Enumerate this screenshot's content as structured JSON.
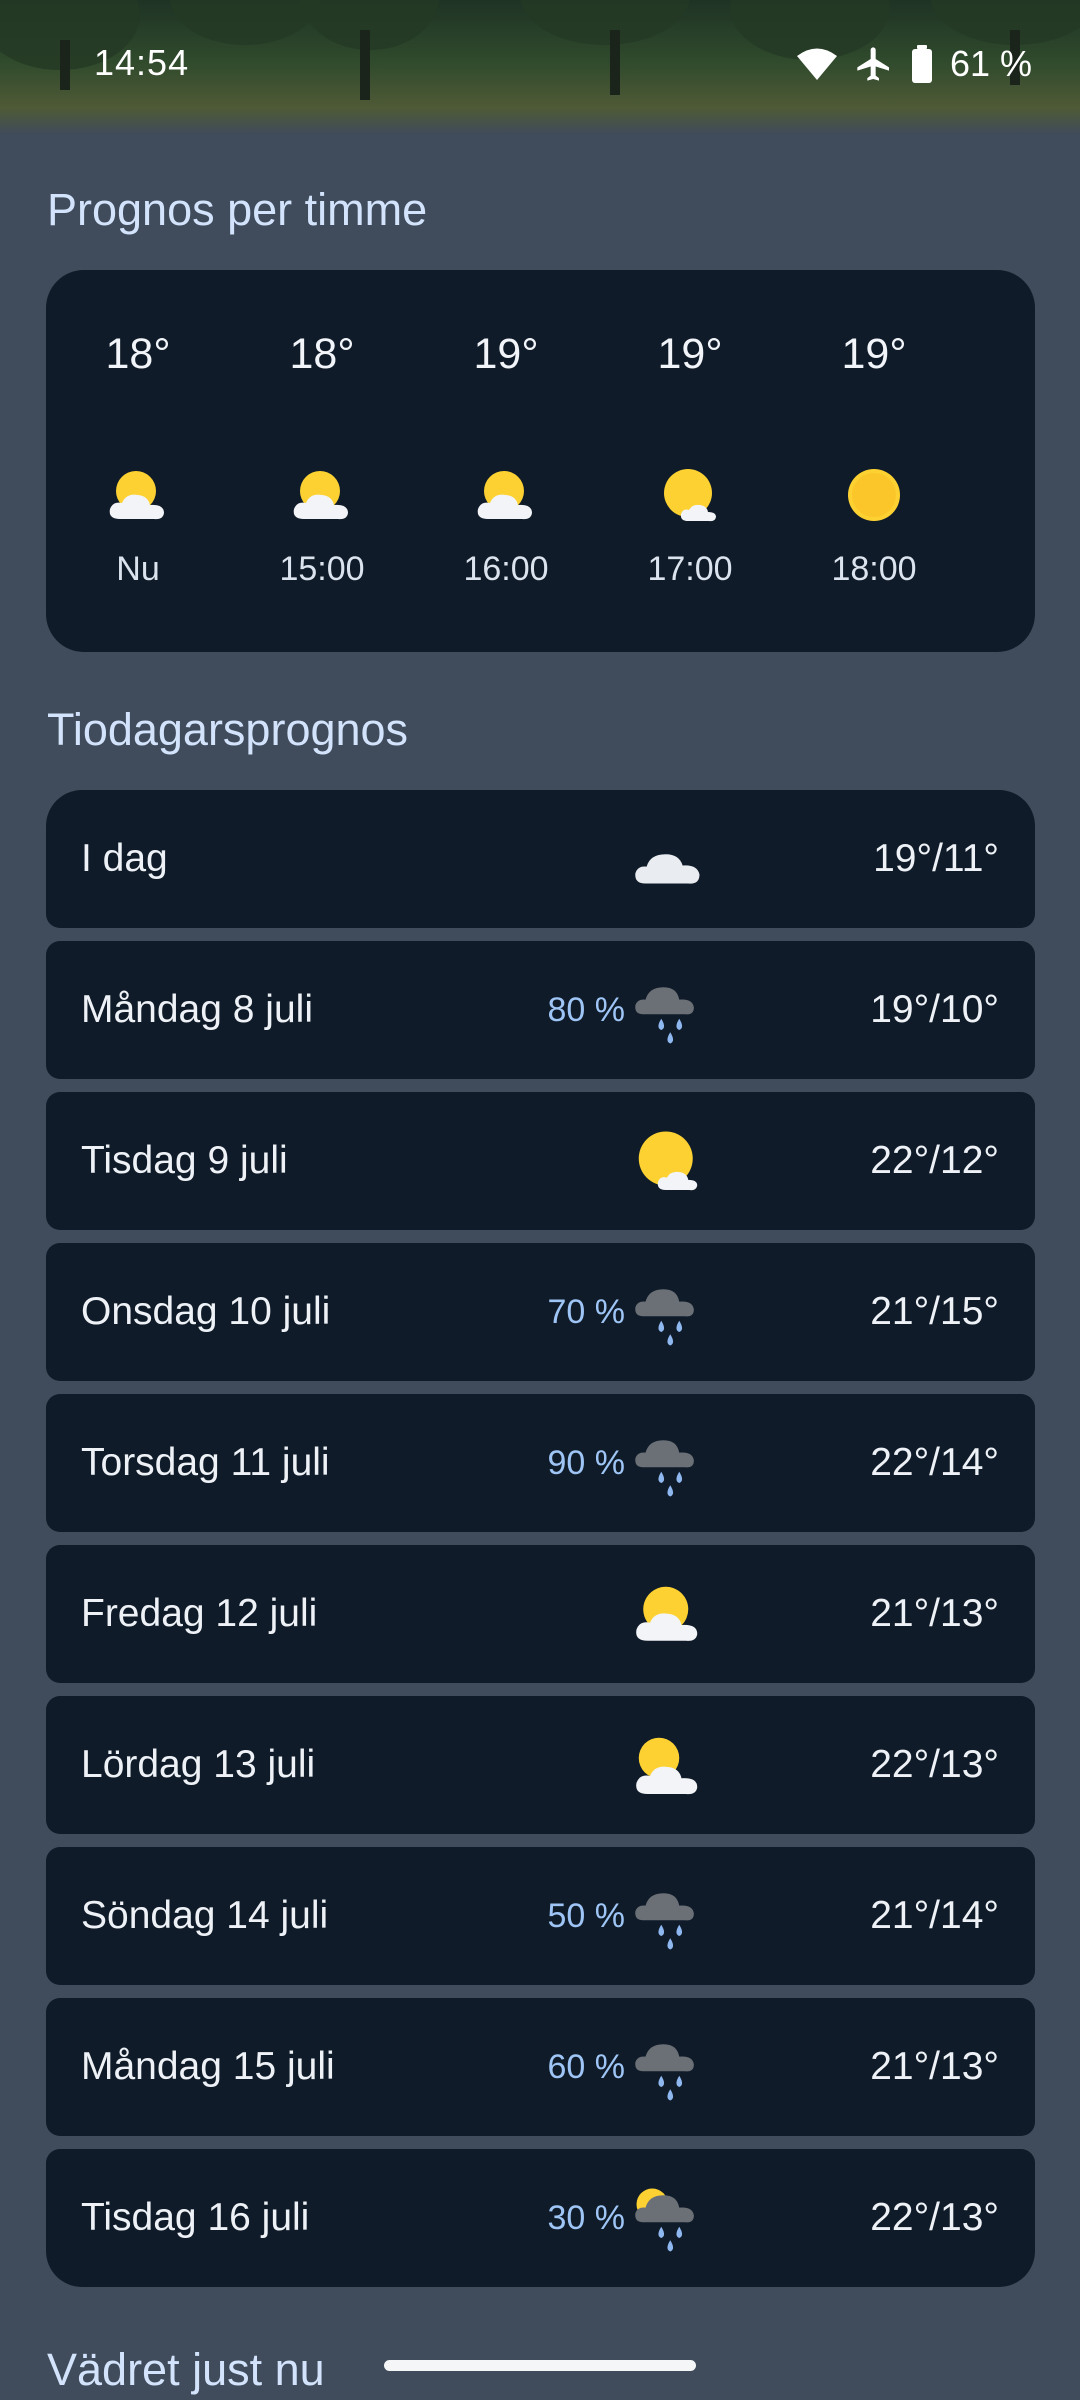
{
  "status_bar": {
    "time": "14:54",
    "battery": "61 %"
  },
  "hourly": {
    "title": "Prognos per timme",
    "items": [
      {
        "temp": "18°",
        "label": "Nu",
        "icon": "partly-cloudy-icon"
      },
      {
        "temp": "18°",
        "label": "15:00",
        "icon": "partly-cloudy-icon"
      },
      {
        "temp": "19°",
        "label": "16:00",
        "icon": "partly-cloudy-icon"
      },
      {
        "temp": "19°",
        "label": "17:00",
        "icon": "mostly-sunny-icon"
      },
      {
        "temp": "19°",
        "label": "18:00",
        "icon": "sunny-icon"
      }
    ]
  },
  "ten_day": {
    "title": "Tiodagarsprognos",
    "days": [
      {
        "name": "I dag",
        "precip": "",
        "icon": "cloudy-icon",
        "temps": "19°/11°"
      },
      {
        "name": "Måndag 8 juli",
        "precip": "80 %",
        "icon": "rain-icon",
        "temps": "19°/10°"
      },
      {
        "name": "Tisdag 9 juli",
        "precip": "",
        "icon": "mostly-sunny-icon",
        "temps": "22°/12°"
      },
      {
        "name": "Onsdag 10 juli",
        "precip": "70 %",
        "icon": "rain-icon",
        "temps": "21°/15°"
      },
      {
        "name": "Torsdag 11 juli",
        "precip": "90 %",
        "icon": "rain-icon",
        "temps": "22°/14°"
      },
      {
        "name": "Fredag 12 juli",
        "precip": "",
        "icon": "partly-cloudy-icon",
        "temps": "21°/13°"
      },
      {
        "name": "Lördag 13 juli",
        "precip": "",
        "icon": "partly-cloudy-icon",
        "temps": "22°/13°"
      },
      {
        "name": "Söndag 14 juli",
        "precip": "50 %",
        "icon": "rain-icon",
        "temps": "21°/14°"
      },
      {
        "name": "Måndag 15 juli",
        "precip": "60 %",
        "icon": "rain-icon",
        "temps": "21°/13°"
      },
      {
        "name": "Tisdag 16 juli",
        "precip": "30 %",
        "icon": "sun-rain-icon",
        "temps": "22°/13°"
      }
    ]
  },
  "current": {
    "title": "Vädret just nu"
  },
  "colors": {
    "background": "#404b5b",
    "card": "#0f1b28",
    "heading": "#d2e3fb",
    "precip": "#9ec5f5",
    "sun": "#fcd131"
  }
}
